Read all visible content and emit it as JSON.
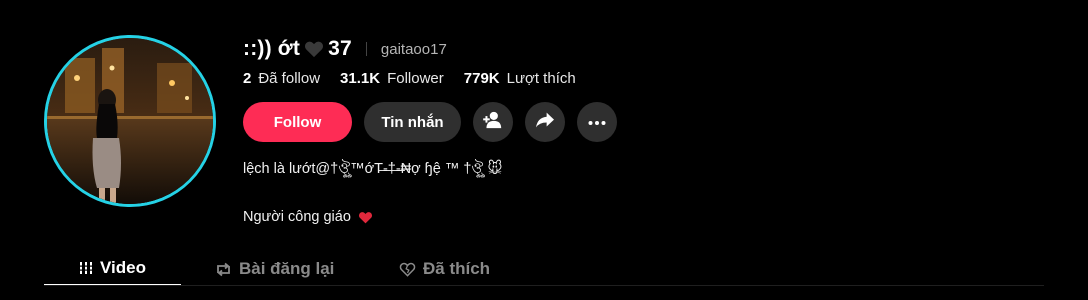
{
  "profile": {
    "display_name": "::)) ớt",
    "name_suffix": "37",
    "username": "gaitaoo17",
    "avatar_ring_color": "#25d2e6"
  },
  "stats": {
    "following_count": "2",
    "following_label": "Đã follow",
    "followers_count": "31.1K",
    "followers_label": "Follower",
    "likes_count": "779K",
    "likes_label": "Lượt thích"
  },
  "actions": {
    "follow_label": "Follow",
    "message_label": "Tin nhắn",
    "follow_color": "#fe2c55"
  },
  "icons": {
    "name_heart": "black-heart-icon",
    "suggest": "add-person-icon",
    "share": "share-arrow-icon",
    "more": "more-dots-icon",
    "bio_heart": "red-heart-icon",
    "video_tab": "grid-icon",
    "repost_tab": "repost-icon",
    "liked_tab": "heart-outline-icon"
  },
  "bio": {
    "line1": "lệch là lướt@†ঔৣ™ớT̶-̶†̶-̶₦ợ ɧệ ™ †ঔৣ 🐭",
    "line2": "Người công giáo"
  },
  "tabs": [
    {
      "label": "Video"
    },
    {
      "label": "Bài đăng lại"
    },
    {
      "label": "Đã thích"
    }
  ]
}
